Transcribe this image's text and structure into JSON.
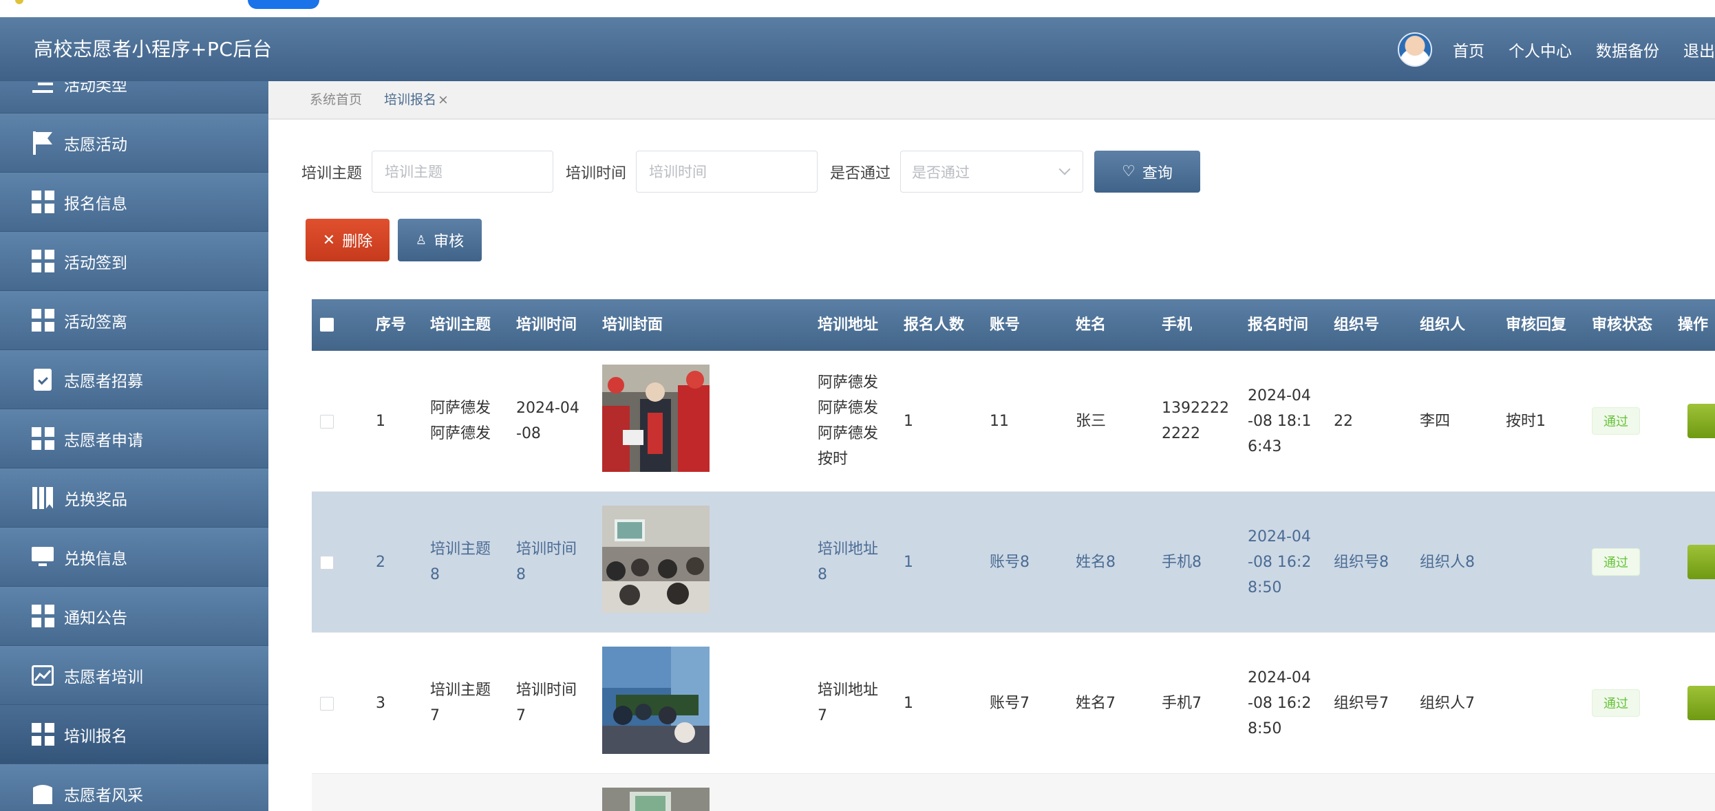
{
  "app": {
    "title": "高校志愿者小程序+PC后台",
    "nav": [
      "首页",
      "个人中心",
      "数据备份",
      "退出登录"
    ]
  },
  "sidebar": {
    "items": [
      {
        "label": "活动类型",
        "icon": "list-icon"
      },
      {
        "label": "志愿活动",
        "icon": "flag-icon"
      },
      {
        "label": "报名信息",
        "icon": "grid-icon"
      },
      {
        "label": "活动签到",
        "icon": "grid-icon"
      },
      {
        "label": "活动签离",
        "icon": "grid-icon"
      },
      {
        "label": "志愿者招募",
        "icon": "clipboard-check-icon"
      },
      {
        "label": "志愿者申请",
        "icon": "grid-icon"
      },
      {
        "label": "兑换奖品",
        "icon": "book-icon"
      },
      {
        "label": "兑换信息",
        "icon": "monitor-icon"
      },
      {
        "label": "通知公告",
        "icon": "grid-icon"
      },
      {
        "label": "志愿者培训",
        "icon": "chart-icon"
      },
      {
        "label": "培训报名",
        "icon": "grid-icon",
        "active": true
      },
      {
        "label": "志愿者风采",
        "icon": "image-icon"
      }
    ]
  },
  "breadcrumb": {
    "home": "系统首页",
    "current": "培训报名",
    "close": "×"
  },
  "filters": {
    "topic_label": "培训主题",
    "topic_placeholder": "培训主题",
    "time_label": "培训时间",
    "time_placeholder": "培训时间",
    "pass_label": "是否通过",
    "pass_placeholder": "是否通过",
    "query_label": "查询"
  },
  "actions": {
    "delete_label": "删除",
    "audit_label": "审核"
  },
  "table": {
    "headers": [
      "序号",
      "培训主题",
      "培训时间",
      "培训封面",
      "培训地址",
      "报名人数",
      "账号",
      "姓名",
      "手机",
      "报名时间",
      "组织号",
      "组织人",
      "审核回复",
      "审核状态",
      "操作"
    ],
    "rows": [
      {
        "no": "1",
        "topic": "阿萨德发\n阿萨德发",
        "time": "2024-04\n-08",
        "address": "阿萨德发\n阿萨德发\n阿萨德发\n按时",
        "count": "1",
        "account": "11",
        "name": "张三",
        "phone": "1392222\n2222",
        "signup_time": "2024-04\n-08 18:1\n6:43",
        "org_no": "22",
        "organizer": "李四",
        "reply": "按时1",
        "status": "通过"
      },
      {
        "no": "2",
        "topic": "培训主题\n8",
        "time": "培训时间\n8",
        "address": "培训地址\n8",
        "count": "1",
        "account": "账号8",
        "name": "姓名8",
        "phone": "手机8",
        "signup_time": "2024-04\n-08 16:2\n8:50",
        "org_no": "组织号8",
        "organizer": "组织人8",
        "reply": "",
        "status": "通过"
      },
      {
        "no": "3",
        "topic": "培训主题\n7",
        "time": "培训时间\n7",
        "address": "培训地址\n7",
        "count": "1",
        "account": "账号7",
        "name": "姓名7",
        "phone": "手机7",
        "signup_time": "2024-04\n-08 16:2\n8:50",
        "org_no": "组织号7",
        "organizer": "组织人7",
        "reply": "",
        "status": "通过"
      }
    ]
  },
  "colors": {
    "header": "#4a6d94",
    "accent": "#5d80a6",
    "danger": "#d8452a",
    "success": "#67c23a",
    "row_alt": "#cdd8e5"
  }
}
